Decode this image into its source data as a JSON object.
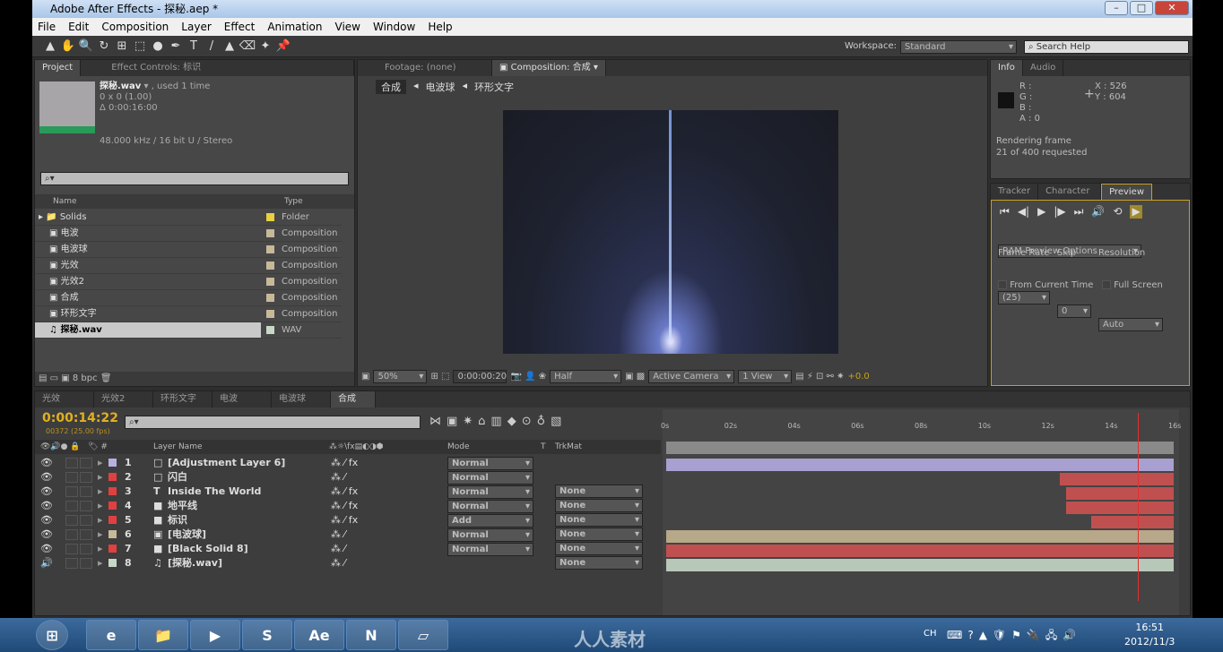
{
  "title": "Adobe After Effects - 探秘.aep *",
  "window_controls": [
    "–",
    "□",
    "✕"
  ],
  "menu": [
    "File",
    "Edit",
    "Composition",
    "Layer",
    "Effect",
    "Animation",
    "View",
    "Window",
    "Help"
  ],
  "toolbar": {
    "tools": [
      "▲",
      "✋",
      "🔍",
      "↻",
      "⊞",
      "⬚",
      "●",
      "✒",
      "T",
      "/",
      "▲",
      "⌫",
      "✦",
      "📌"
    ],
    "workspace_label": "Workspace:",
    "workspace_value": "Standard",
    "search_placeholder": "Search Help"
  },
  "project": {
    "tabs": [
      "Project",
      "Effect Controls: 标识"
    ],
    "item_name": "探秘.wav",
    "item_used": ", used 1 time",
    "dims": "0 x 0 (1.00)",
    "duration": "Δ 0:00:16:00",
    "audio": "48.000 kHz / 16 bit U / Stereo",
    "search_placeholder": "",
    "col_name": "Name",
    "col_type": "Type",
    "bpc": "8 bpc",
    "items": [
      {
        "name": "Solids",
        "type": "Folder",
        "color": "#e8d040",
        "icon": "folder"
      },
      {
        "name": "电波",
        "type": "Composition",
        "color": "#c8b89a",
        "icon": "comp"
      },
      {
        "name": "电波球",
        "type": "Composition",
        "color": "#c8b89a",
        "icon": "comp"
      },
      {
        "name": "光效",
        "type": "Composition",
        "color": "#c8b89a",
        "icon": "comp"
      },
      {
        "name": "光效2",
        "type": "Composition",
        "color": "#c8b89a",
        "icon": "comp"
      },
      {
        "name": "合成",
        "type": "Composition",
        "color": "#c8b89a",
        "icon": "comp"
      },
      {
        "name": "环形文字",
        "type": "Composition",
        "color": "#c8b89a",
        "icon": "comp"
      },
      {
        "name": "探秘.wav",
        "type": "WAV",
        "color": "#c8d8c8",
        "icon": "audio",
        "selected": true
      }
    ]
  },
  "viewer": {
    "tabs": [
      "Footage: (none)",
      "Composition: 合成"
    ],
    "breadcrumbs": [
      "合成",
      "电波球",
      "环形文字"
    ],
    "zoom": "50%",
    "timecode": "0:00:00:20",
    "resolution": "Half",
    "camera": "Active Camera",
    "views": "1 View",
    "exposure": "+0.0"
  },
  "info": {
    "tabs": [
      "Info",
      "Audio"
    ],
    "r": "R :",
    "g": "G :",
    "b": "B :",
    "a": "A : 0",
    "x": "X : 526",
    "y": "Y : 604",
    "status1": "Rendering frame",
    "status2": "21 of 400 requested"
  },
  "preview": {
    "tabs": [
      "Tracker",
      "Character",
      "Preview"
    ],
    "controls": [
      "⏮",
      "◀|",
      "▶",
      "|▶",
      "⏭",
      "🔊",
      "⟲",
      "▶"
    ],
    "ram_options": "RAM Preview Options",
    "frame_rate_label": "Frame Rate",
    "frame_rate": "(25)",
    "skip_label": "Skip",
    "skip": "0",
    "resolution_label": "Resolution",
    "resolution": "Auto",
    "from_current": "From Current Time",
    "full_screen": "Full Screen"
  },
  "timeline": {
    "tabs": [
      "光效",
      "光效2",
      "环形文字",
      "电波",
      "电波球",
      "合成"
    ],
    "timecode": "0:00:14:22",
    "frames": "00372 (25.00 fps)",
    "col_layer_name": "Layer Name",
    "col_mode": "Mode",
    "col_t": "T",
    "col_trkmat": "TrkMat",
    "ruler": [
      "0s",
      "02s",
      "04s",
      "06s",
      "08s",
      "10s",
      "12s",
      "14s",
      "16s"
    ],
    "duration_seconds": 16,
    "current_time_seconds": 14.88,
    "layers": [
      {
        "num": "1",
        "name": "[Adjustment Layer 6]",
        "label_color": "#b8b0e0",
        "mode": "Normal",
        "trkmat": "",
        "fx": true,
        "bar_color": "#a8a0d0",
        "in": 0,
        "out": 16
      },
      {
        "num": "2",
        "name": "闪白",
        "label_color": "#e04040",
        "mode": "Normal",
        "trkmat": "None",
        "fx": false,
        "bar_color": "#c05050",
        "in": 12.4,
        "out": 16
      },
      {
        "num": "3",
        "name": "Inside The World",
        "label_color": "#e04040",
        "mode": "Normal",
        "trkmat": "None",
        "fx": true,
        "bar_color": "#c05050",
        "in": 12.6,
        "out": 16
      },
      {
        "num": "4",
        "name": "地平线",
        "label_color": "#e04040",
        "mode": "Normal",
        "trkmat": "None",
        "fx": true,
        "bar_color": "#c05050",
        "in": 12.6,
        "out": 16
      },
      {
        "num": "5",
        "name": "标识",
        "label_color": "#e04040",
        "mode": "Add",
        "trkmat": "None",
        "fx": true,
        "bar_color": "#c05050",
        "in": 13.4,
        "out": 16
      },
      {
        "num": "6",
        "name": "[电波球]",
        "label_color": "#c8b89a",
        "mode": "Normal",
        "trkmat": "None",
        "fx": false,
        "bar_color": "#b8a88a",
        "in": 0,
        "out": 16
      },
      {
        "num": "7",
        "name": "[Black Solid 8]",
        "label_color": "#e04040",
        "mode": "Normal",
        "trkmat": "None",
        "fx": false,
        "bar_color": "#c05050",
        "in": 0,
        "out": 16
      },
      {
        "num": "8",
        "name": "[探秘.wav]",
        "label_color": "#c8d8c8",
        "mode": "",
        "trkmat": "",
        "fx": false,
        "bar_color": "#b8c8b8",
        "in": 0,
        "out": 16
      }
    ]
  },
  "taskbar": {
    "apps": [
      "⊞",
      "e",
      "📁",
      "▶",
      "S",
      "Ae",
      "N",
      "▱"
    ],
    "lang": "CH",
    "time": "16:51",
    "date": "2012/11/3",
    "watermark": "人人素材"
  }
}
